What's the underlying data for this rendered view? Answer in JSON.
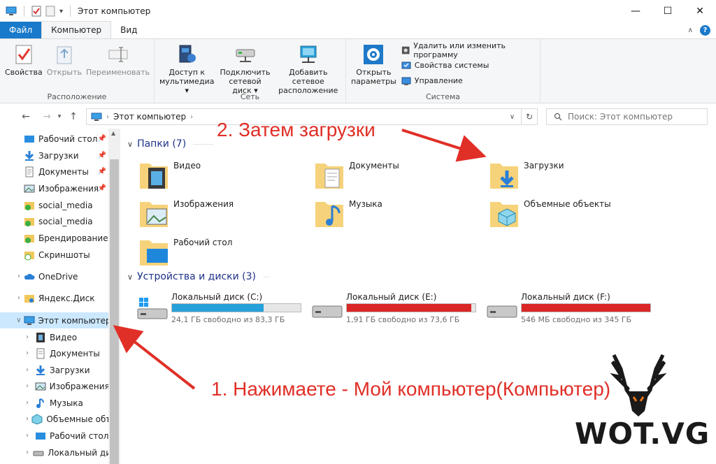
{
  "window": {
    "title": "Этот компьютер",
    "controls": {
      "minimize": "—",
      "maximize": "☐",
      "close": "✕"
    }
  },
  "tabs": [
    {
      "label": "Файл"
    },
    {
      "label": "Компьютер"
    },
    {
      "label": "Вид"
    }
  ],
  "ribbon": {
    "location": {
      "label": "Расположение",
      "properties": "Свойства",
      "open": "Открыть",
      "rename": "Переименовать"
    },
    "network": {
      "label": "Сеть",
      "media_line1": "Доступ к",
      "media_line2": "мультимедиа ▾",
      "map_line1": "Подключить",
      "map_line2": "сетевой диск ▾",
      "add_line1": "Добавить сетевое",
      "add_line2": "расположение"
    },
    "system": {
      "label": "Система",
      "open_line1": "Открыть",
      "open_line2": "параметры",
      "uninstall": "Удалить или изменить программу",
      "sysprops": "Свойства системы",
      "manage": "Управление"
    }
  },
  "address": {
    "path": "Этот компьютер",
    "search_placeholder": "Поиск: Этот компьютер"
  },
  "sidebar": {
    "items": [
      {
        "label": "Рабочий стол"
      },
      {
        "label": "Загрузки"
      },
      {
        "label": "Документы"
      },
      {
        "label": "Изображения"
      },
      {
        "label": "social_media"
      },
      {
        "label": "social_media"
      },
      {
        "label": "Брендирование"
      },
      {
        "label": "Скриншоты"
      },
      {
        "label": "OneDrive"
      },
      {
        "label": "Яндекс.Диск"
      },
      {
        "label": "Этот компьютер"
      },
      {
        "label": "Видео"
      },
      {
        "label": "Документы"
      },
      {
        "label": "Загрузки"
      },
      {
        "label": "Изображения"
      },
      {
        "label": "Музыка"
      },
      {
        "label": "Объемные объекты"
      },
      {
        "label": "Рабочий стол"
      },
      {
        "label": "Локальный диск"
      }
    ]
  },
  "folders_section": {
    "title": "Папки (7)"
  },
  "folders": [
    {
      "name": "Видео"
    },
    {
      "name": "Документы"
    },
    {
      "name": "Загрузки"
    },
    {
      "name": "Изображения"
    },
    {
      "name": "Музыка"
    },
    {
      "name": "Объемные объекты"
    },
    {
      "name": "Рабочий стол"
    }
  ],
  "drives_section": {
    "title": "Устройства и диски (3)"
  },
  "drives": [
    {
      "name": "Локальный диск (C:)",
      "free": "24,1 ГБ свободно из 83,3 ГБ",
      "used_fraction": 0.71,
      "color": "#26a0da"
    },
    {
      "name": "Локальный диск (E:)",
      "free": "1,91 ГБ свободно из 73,6 ГБ",
      "used_fraction": 0.97,
      "color": "#da2626"
    },
    {
      "name": "Локальный диск (F:)",
      "free": "546 МБ свободно из 345 ГБ",
      "used_fraction": 0.998,
      "color": "#da2626"
    }
  ],
  "annotations": {
    "step2": "2. Затем загрузки",
    "step1": "1. Нажимаете - Мой компьютер(Компьютер)"
  },
  "logo": {
    "text": "WOT.VG"
  },
  "colors": {
    "accent": "#1979ca",
    "annotation": "#e02f27",
    "selection": "#cce8ff"
  }
}
